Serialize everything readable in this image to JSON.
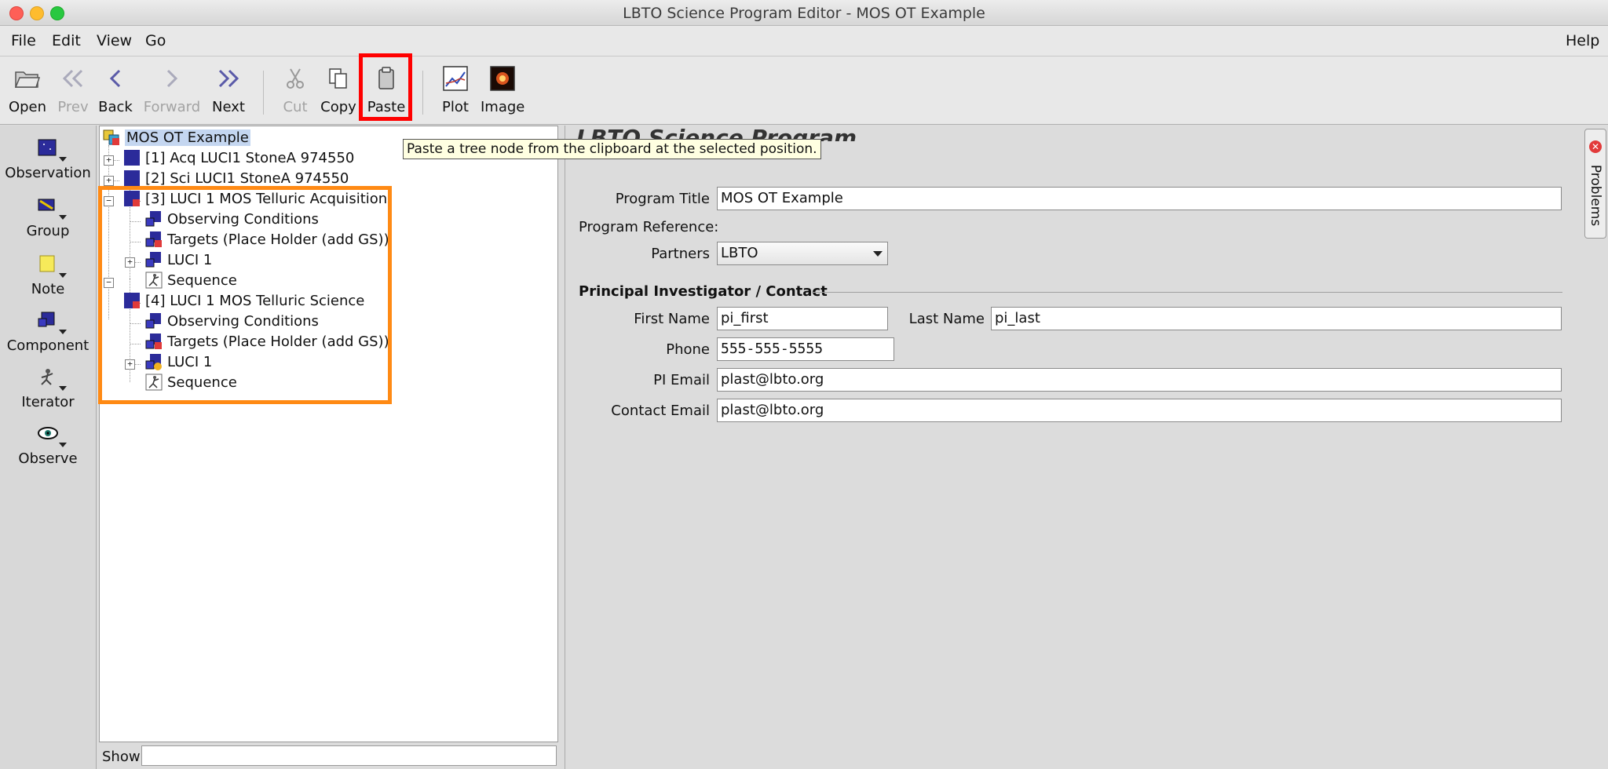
{
  "window": {
    "title": "LBTO Science Program Editor - MOS OT Example"
  },
  "menubar": {
    "file": "File",
    "edit": "Edit",
    "view": "View",
    "go": "Go",
    "help": "Help"
  },
  "toolbar": {
    "open": "Open",
    "prev": "Prev",
    "back": "Back",
    "forward": "Forward",
    "next": "Next",
    "cut": "Cut",
    "copy": "Copy",
    "paste": "Paste",
    "plot": "Plot",
    "image": "Image"
  },
  "tooltip": "Paste a tree node from the clipboard at the selected position.",
  "palette": {
    "observation": "Observation",
    "group": "Group",
    "note": "Note",
    "component": "Component",
    "iterator": "Iterator",
    "observe": "Observe"
  },
  "tree": {
    "root": "MOS OT Example",
    "obs1": "[1] Acq LUCI1 StoneA 974550",
    "obs2": "[2] Sci LUCI1 StoneA 974550",
    "obs3": "[3] LUCI 1 MOS Telluric Acquisition",
    "obs3_conditions": "Observing Conditions",
    "obs3_targets": "Targets (Place Holder (add GS))",
    "obs3_luci": "LUCI 1",
    "obs3_sequence": "Sequence",
    "obs4": "[4] LUCI 1 MOS Telluric Science",
    "obs4_conditions": "Observing Conditions",
    "obs4_targets": "Targets (Place Holder (add GS))",
    "obs4_luci": "LUCI 1",
    "obs4_sequence": "Sequence"
  },
  "show": {
    "label": "Show",
    "value": ""
  },
  "program": {
    "heading": "LBTO Science Program",
    "title_label": "Program Title",
    "title_value": "MOS OT Example",
    "reference_label": "Program Reference:",
    "partners_label": "Partners",
    "partners_value": "LBTO",
    "pi_section": "Principal Investigator / Contact",
    "first_name_label": "First Name",
    "first_name_value": "pi_first",
    "last_name_label": "Last Name",
    "last_name_value": "pi_last",
    "phone_label": "Phone",
    "phone_value": "555-555-5555",
    "pi_email_label": "PI Email",
    "pi_email_value": "plast@lbto.org",
    "contact_email_label": "Contact Email",
    "contact_email_value": "plast@lbto.org"
  },
  "problems_tab": {
    "label": "Problems"
  },
  "colors": {
    "highlight_paste": "#ff0000",
    "highlight_tree": "#ff8a14",
    "tooltip_bg": "#ffffe1",
    "selection": "#c4d6f0"
  }
}
